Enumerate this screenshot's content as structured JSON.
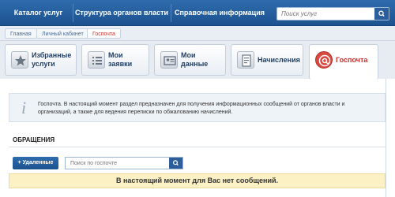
{
  "nav": {
    "items": [
      "Каталог услуг",
      "Структура органов власти",
      "Справочная информация"
    ],
    "search_placeholder": "Поиск услуг"
  },
  "breadcrumb": [
    "Главная",
    "Личный кабинет",
    "Госпочта"
  ],
  "tabs": [
    {
      "label": "Избранные услуги",
      "icon": "star-icon"
    },
    {
      "label": "Мои заявки",
      "icon": "list-icon"
    },
    {
      "label": "Мои данные",
      "icon": "profile-icon"
    },
    {
      "label": "Начисления",
      "icon": "invoice-icon"
    },
    {
      "label": "Госпочта",
      "icon": "at-sign-icon",
      "active": true
    }
  ],
  "info": {
    "text": "Госпочта. В настоящий момент раздел предназначен для получения информационных сообщений от органов власти и организаций, а также для ведения переписки по обжалованию начислений."
  },
  "section": {
    "title": "ОБРАЩЕНИЯ",
    "deleted_button": "+ Удаленные",
    "search_placeholder": "Поиск по госпочте"
  },
  "notice": "В настоящий момент для Вас нет сообщений.",
  "colors": {
    "nav_bg": "#1c5290",
    "active_accent": "#c7302c",
    "notice_bg": "#fbf1c4"
  }
}
